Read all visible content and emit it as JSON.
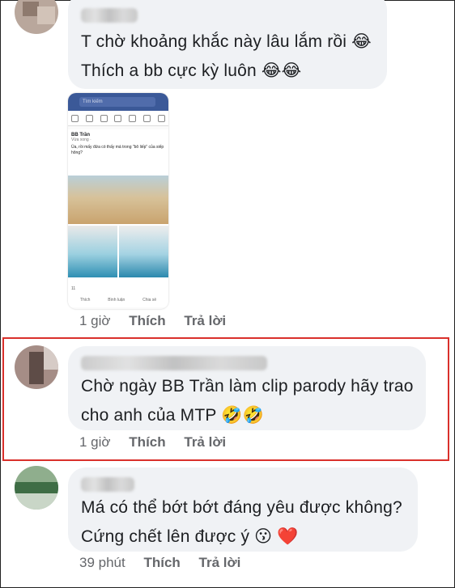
{
  "comments": [
    {
      "lines": [
        "T chờ khoảng khắc này lâu lắm rồi 😂",
        "Thích a bb cực kỳ luôn 😂😂"
      ],
      "time": "1 giờ",
      "like": "Thích",
      "reply": "Trả lời"
    },
    {
      "lines": [
        "Chờ ngày BB Trần làm clip parody hãy trao",
        "cho anh của MTP 🤣🤣"
      ],
      "time": "1 giờ",
      "like": "Thích",
      "reply": "Trả lời"
    },
    {
      "lines": [
        "Má có thể bớt bớt đáng yêu được không?",
        "Cứng chết lên được ý 😗 ❤️"
      ],
      "time": "39 phút",
      "like": "Thích",
      "reply": "Trả lời"
    }
  ],
  "attachment": {
    "search_placeholder": "Tìm kiếm",
    "post_author": "BB Trần",
    "post_sub": "Vừa xong ·",
    "post_caption": "Ủa, rồi mấy đứa có thấy má trong \"bô liếp\" của siếp hông?",
    "reaction_count": "11",
    "actions": [
      "Thích",
      "Bình luận",
      "Chia sẻ"
    ]
  },
  "colors": {
    "bubble": "#f0f2f5",
    "highlight": "#d9302b",
    "meta": "#65676b",
    "fb_blue": "#3b5998"
  }
}
